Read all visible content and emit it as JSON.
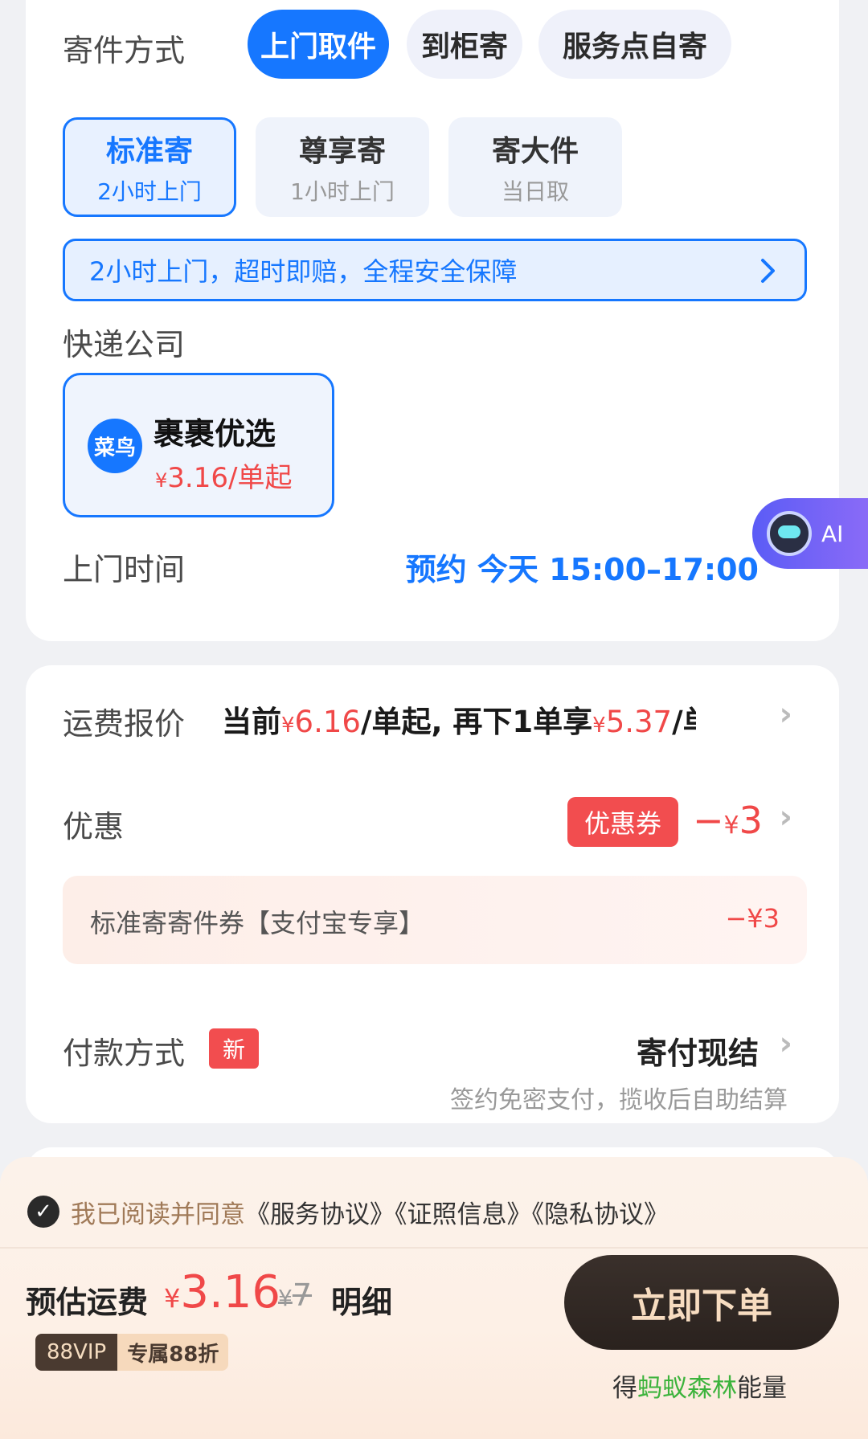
{
  "method": {
    "label": "寄件方式",
    "options": [
      "上门取件",
      "到柜寄",
      "服务点自寄"
    ],
    "selected": "上门取件"
  },
  "service_types": [
    {
      "title": "标准寄",
      "sub": "2小时上门",
      "selected": true
    },
    {
      "title": "尊享寄",
      "sub": "1小时上门",
      "selected": false
    },
    {
      "title": "寄大件",
      "sub": "当日取",
      "selected": false
    }
  ],
  "banner": {
    "text": "2小时上门，超时即赔，全程安全保障",
    "icon": "chevron-right-icon"
  },
  "courier": {
    "label": "快递公司",
    "logo_text": "菜鸟",
    "name": "裹裹优选",
    "price_yen": "¥",
    "price": "3.16/单起"
  },
  "ai": {
    "label": "AI"
  },
  "pickup_time": {
    "label": "上门时间",
    "value": "预约 今天 15:00–17:00"
  },
  "quote": {
    "label": "运费报价",
    "prefix": "当前",
    "yen": "¥",
    "current": "6.16",
    "mid": "/单起, 再下1单享",
    "next": "5.37",
    "suffix": "/单起"
  },
  "discount": {
    "label": "优惠",
    "badge": "优惠券",
    "minus": "−",
    "yen": "¥",
    "amount": "3"
  },
  "coupon": {
    "name": "标准寄寄件券【支付宝专享】",
    "amount": "−¥3"
  },
  "payment": {
    "label": "付款方式",
    "badge": "新",
    "value": "寄付现结",
    "sub": "签约免密支付，揽收后自助结算"
  },
  "agreement": {
    "lead": "我已阅读并同意",
    "docs": "《服务协议》《证照信息》《隐私协议》"
  },
  "summary": {
    "label": "预估运费",
    "yen": "¥",
    "price": "3.16",
    "original": "7",
    "detail": "明细",
    "vip": "88VIP",
    "vip_off": "专属88折",
    "order_button": "立即下单",
    "energy_lead": "得",
    "energy_brand": "蚂蚁森林",
    "energy_tail": "能量"
  },
  "colors": {
    "primary": "#1677ff",
    "price_red": "#f04848",
    "order_button": "#2e2521"
  }
}
